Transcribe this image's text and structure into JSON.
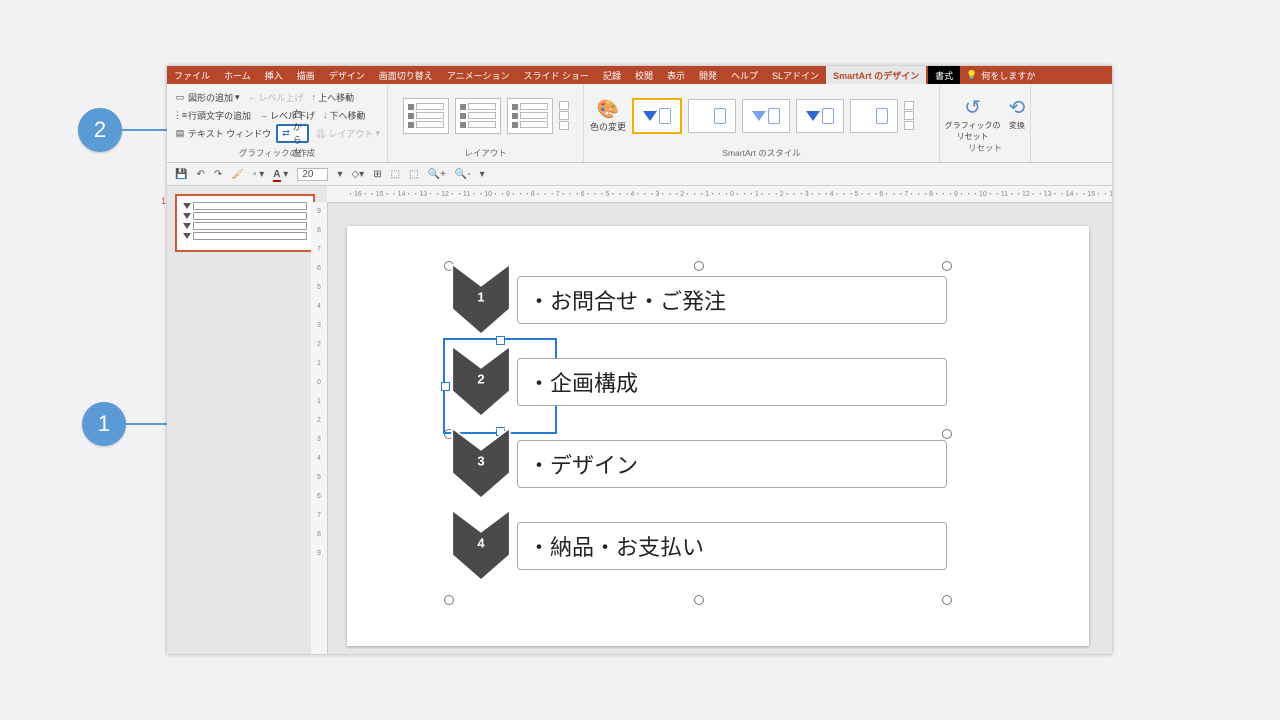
{
  "tabs": {
    "file": "ファイル",
    "home": "ホーム",
    "insert": "挿入",
    "draw": "描画",
    "design": "デザイン",
    "transitions": "画面切り替え",
    "animations": "アニメーション",
    "slideshow": "スライド ショー",
    "record": "記録",
    "review": "校閲",
    "view": "表示",
    "developer": "開発",
    "help": "ヘルプ",
    "sladdin": "SLアドイン",
    "smartart": "SmartArt のデザイン",
    "format": "書式",
    "tell": "何をしますか"
  },
  "ribbon": {
    "create": {
      "add_shape": "図形の追加",
      "level_up": "レベル上げ",
      "move_up": "上へ移動",
      "add_bullet": "行頭文字の追加",
      "level_down": "レベル下げ",
      "move_down": "下へ移動",
      "text_pane": "テキスト ウィンドウ",
      "rtl": "右から左",
      "layout_btn": "レイアウト",
      "label": "グラフィックの作成"
    },
    "layout_label": "レイアウト",
    "color_change": "色の変更",
    "styles_label": "SmartArt のスタイル",
    "reset": {
      "reset": "グラフィックの\nリセット",
      "convert": "変換",
      "label": "リセット"
    }
  },
  "qat": {
    "font_size": "20"
  },
  "callouts": {
    "c1": "1",
    "c2": "2"
  },
  "thumb_num": "1",
  "ruler_h": "・16・・15・・14・・13・・12・・11・・10・・9・・・8・・・7・・・6・・・5・・・4・・・3・・・2・・・1・・・0・・・1・・・2・・・3・・・4・・・5・・・6・・・7・・・8・・・9・・・10・・11・・12・・13・・14・・15・・16・",
  "ruler_v": [
    "9",
    "8",
    "7",
    "6",
    "5",
    "4",
    "3",
    "2",
    "1",
    "0",
    "1",
    "2",
    "3",
    "4",
    "5",
    "6",
    "7",
    "8",
    "9"
  ],
  "smartart": {
    "items": [
      {
        "num": "1",
        "text": "・お問合せ・ご発注"
      },
      {
        "num": "2",
        "text": "・企画構成"
      },
      {
        "num": "3",
        "text": "・デザイン"
      },
      {
        "num": "4",
        "text": "・納品・お支払い"
      }
    ]
  }
}
